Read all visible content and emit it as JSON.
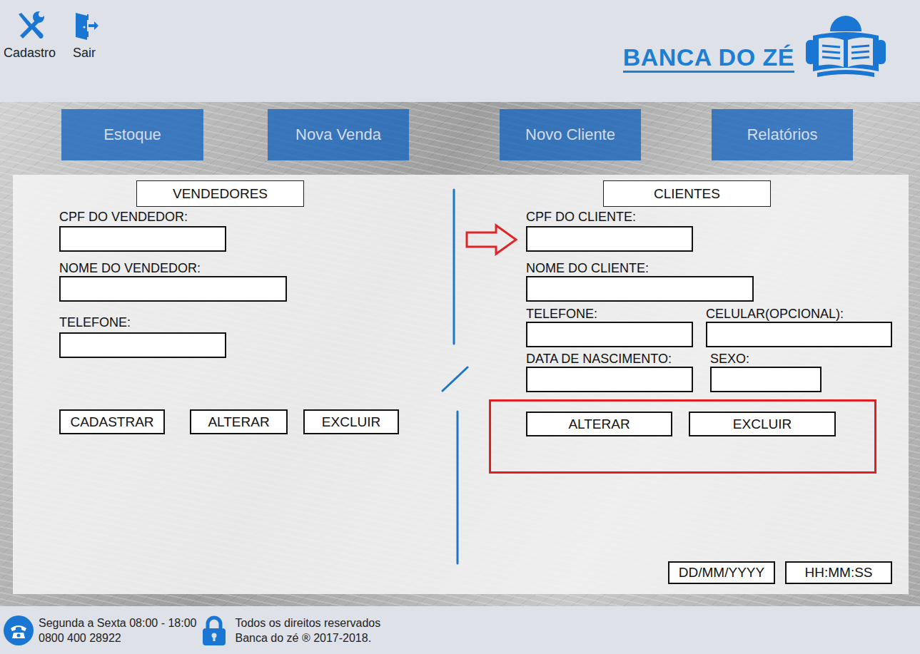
{
  "toolbar": [
    {
      "label": "Cadastro"
    },
    {
      "label": "Sair"
    }
  ],
  "logo": {
    "text": "BANCA DO ZÉ"
  },
  "nav": [
    {
      "label": "Estoque"
    },
    {
      "label": "Nova Venda"
    },
    {
      "label": "Novo Cliente"
    },
    {
      "label": "Relatórios"
    }
  ],
  "sellers": {
    "title": "VENDEDORES",
    "fields": [
      {
        "label": "CPF DO VENDEDOR:",
        "pointed": false
      },
      {
        "label": "NOME DO VENDEDOR:",
        "pointed": false
      },
      {
        "label": "TELEFONE:",
        "pointed": false
      }
    ],
    "actions": {
      "highlighted": false,
      "buttons": [
        "CADASTRAR",
        "ALTERAR",
        "EXCLUIR"
      ]
    }
  },
  "clients": {
    "title": "CLIENTES",
    "fields": [
      {
        "label": "CPF DO CLIENTE:",
        "pointed": true
      },
      {
        "label": "NOME DO CLIENTE:",
        "pointed": false
      },
      {
        "label": "TELEFONE:",
        "pointed": false
      },
      {
        "label": "CELULAR(OPCIONAL):",
        "pointed": false
      },
      {
        "label": "DATA DE NASCIMENTO:",
        "pointed": false
      },
      {
        "label": "SEXO:",
        "pointed": false
      }
    ],
    "actions": {
      "highlighted": true,
      "buttons": [
        "ALTERAR",
        "EXCLUIR"
      ]
    }
  },
  "clock": {
    "date": "DD/MM/YYYY",
    "time": "HH:MM:SS"
  },
  "footer": {
    "hours": "Segunda a Sexta 08:00 - 18:00",
    "phone": "0800 400 28922",
    "rights": "Todos os direitos reservados",
    "copyright": "Banca do zé ® 2017-2018."
  }
}
